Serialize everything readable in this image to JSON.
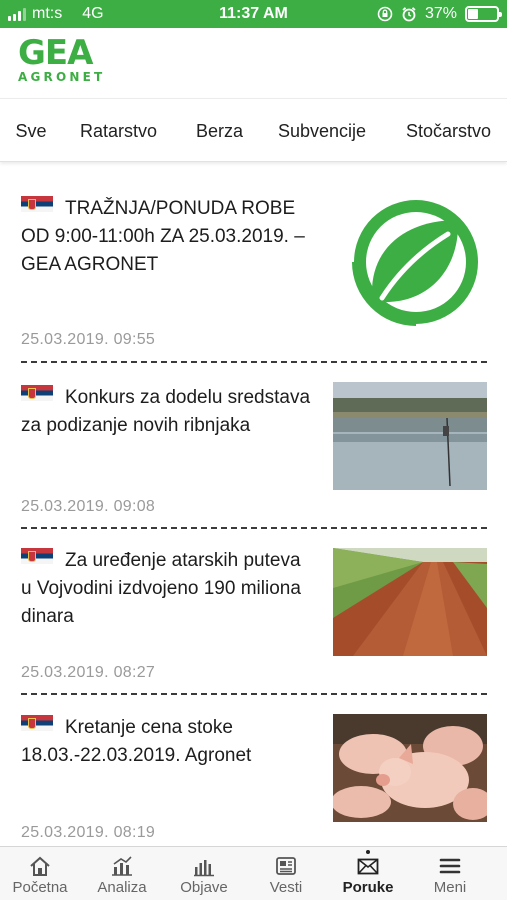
{
  "status_bar": {
    "carrier": "mt:s",
    "network": "4G",
    "time": "11:37 AM",
    "battery": "37%",
    "battery_level": 0.37,
    "color": "#3cae44"
  },
  "header": {
    "logo_main": "GEA",
    "logo_sub": "AGRONET",
    "brand_color": "#3cae44"
  },
  "tabs": [
    {
      "label": "Sve",
      "active": true
    },
    {
      "label": "Ratarstvo"
    },
    {
      "label": "Berza"
    },
    {
      "label": "Subvencije"
    },
    {
      "label": "Stočarstvo"
    }
  ],
  "feed": [
    {
      "title": "TRAŽNJA/PONUDA ROBE OD 9:00-11:00h ZA 25.03.2019. – GEA AGRONET",
      "date": "25.03.2019. 09:55",
      "flag": "serbia-flag",
      "image": "gea-leaf-logo"
    },
    {
      "title": "Konkurs za dodelu sredstava za podizanje novih ribnjaka",
      "date": "25.03.2019. 09:08",
      "flag": "serbia-flag",
      "image": "fish-pond-photo"
    },
    {
      "title": "Za uređenje atarskih puteva u Vojvodini izdvojeno 190 miliona dinara",
      "date": "25.03.2019. 08:27",
      "flag": "serbia-flag",
      "image": "dirt-road-field-photo"
    },
    {
      "title": "Kretanje cena stoke 18.03.-22.03.2019. Agronet",
      "date": "25.03.2019. 08:19",
      "flag": "serbia-flag",
      "image": "pigs-photo"
    }
  ],
  "bottom_nav": [
    {
      "label": "Početna",
      "icon": "home-icon"
    },
    {
      "label": "Analiza",
      "icon": "analytics-chart-icon"
    },
    {
      "label": "Objave",
      "icon": "bar-chart-icon"
    },
    {
      "label": "Vesti",
      "icon": "newspaper-icon"
    },
    {
      "label": "Poruke",
      "icon": "envelope-icon",
      "active": true
    },
    {
      "label": "Meni",
      "icon": "menu-icon"
    }
  ]
}
